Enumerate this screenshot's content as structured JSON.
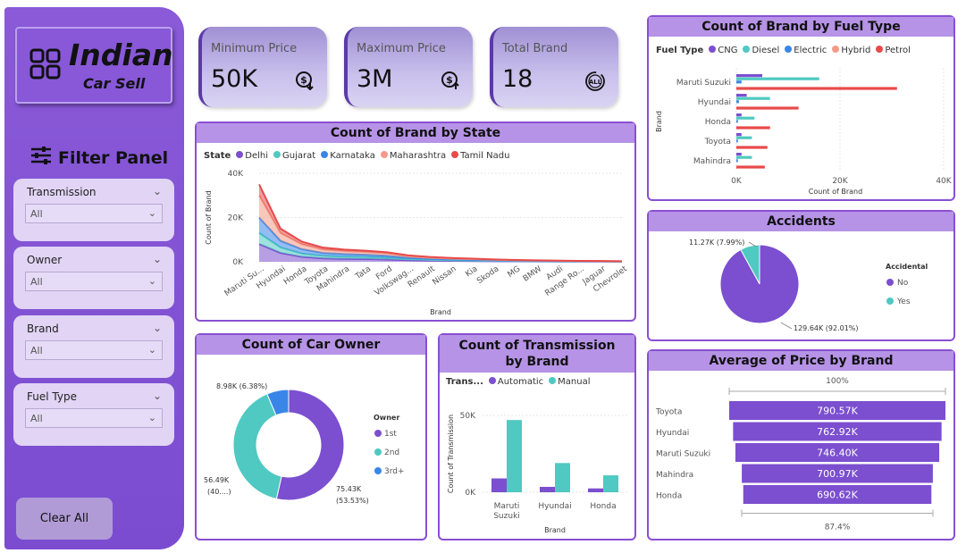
{
  "logo": {
    "title": "Indian",
    "subtitle": "Car Sell"
  },
  "filter_panel": {
    "title": "Filter Panel",
    "slicers": [
      {
        "label": "Transmission",
        "value": "All"
      },
      {
        "label": "Owner",
        "value": "All"
      },
      {
        "label": "Brand",
        "value": "All"
      },
      {
        "label": "Fuel Type",
        "value": "All"
      }
    ],
    "clear_label": "Clear All"
  },
  "kpis": [
    {
      "label": "Minimum Price",
      "value": "50K"
    },
    {
      "label": "Maximum Price",
      "value": "3M"
    },
    {
      "label": "Total Brand",
      "value": "18"
    }
  ],
  "colors": {
    "delhi": "#7b4fcf",
    "gujarat": "#4fc9c1",
    "karnataka": "#3a86e8",
    "maharashtra": "#f29a87",
    "tamilnadu": "#e84a4a"
  },
  "chart_data": [
    {
      "type": "area",
      "title": "Count of Brand by State",
      "legend_title": "State",
      "xlabel": "Brand",
      "ylabel": "Count of Brand",
      "ylim": [
        0,
        40000
      ],
      "y_ticks": [
        "40K",
        "20K",
        "0K"
      ],
      "categories": [
        "Maruti Su...",
        "Hyundai",
        "Honda",
        "Toyota",
        "Mahindra",
        "Tata",
        "Ford",
        "Volkswag...",
        "Renault",
        "Nissan",
        "Kia",
        "Skoda",
        "MG",
        "BMW",
        "Audi",
        "Range Ro...",
        "Jaguar",
        "Chevrolet"
      ],
      "series": [
        {
          "name": "Delhi",
          "values": [
            8000,
            4000,
            2200,
            1500,
            1300,
            1200,
            1000,
            700,
            500,
            400,
            300,
            250,
            200,
            150,
            120,
            100,
            80,
            60
          ]
        },
        {
          "name": "Gujarat",
          "values": [
            5000,
            2500,
            1500,
            1200,
            1000,
            900,
            800,
            500,
            400,
            300,
            250,
            200,
            150,
            120,
            100,
            80,
            60,
            50
          ]
        },
        {
          "name": "Karnataka",
          "values": [
            7000,
            3000,
            2000,
            1300,
            1200,
            1100,
            900,
            600,
            450,
            350,
            300,
            200,
            150,
            120,
            100,
            80,
            60,
            50
          ]
        },
        {
          "name": "Maharashtra",
          "values": [
            10000,
            3500,
            2200,
            1500,
            1300,
            1200,
            1100,
            700,
            500,
            400,
            350,
            250,
            200,
            150,
            120,
            100,
            80,
            60
          ]
        },
        {
          "name": "Tamil Nadu",
          "values": [
            5000,
            2000,
            1200,
            900,
            700,
            600,
            500,
            400,
            300,
            250,
            200,
            150,
            120,
            100,
            80,
            60,
            50,
            40
          ]
        }
      ]
    },
    {
      "type": "bar",
      "title": "Count of Brand by Fuel Type",
      "legend_title": "Fuel Type",
      "xlabel": "Count of Brand",
      "ylabel": "Brand",
      "xlim": [
        0,
        40000
      ],
      "x_ticks": [
        "0K",
        "20K",
        "40K"
      ],
      "categories": [
        "Maruti Suzuki",
        "Hyundai",
        "Honda",
        "Toyota",
        "Mahindra"
      ],
      "series": [
        {
          "name": "CNG",
          "values": [
            5000,
            2000,
            1000,
            1000,
            1000
          ]
        },
        {
          "name": "Diesel",
          "values": [
            16000,
            6500,
            3500,
            3000,
            3000
          ]
        },
        {
          "name": "Electric",
          "values": [
            1000,
            500,
            300,
            300,
            300
          ]
        },
        {
          "name": "Hybrid",
          "values": [
            0,
            0,
            0,
            0,
            0
          ]
        },
        {
          "name": "Petrol",
          "values": [
            31000,
            12000,
            6500,
            6000,
            5500
          ]
        }
      ]
    },
    {
      "type": "pie",
      "title": "Accidents",
      "legend_title": "Accidental",
      "slices": [
        {
          "name": "No",
          "value": 129640,
          "label": "129.64K (92.01%)"
        },
        {
          "name": "Yes",
          "value": 11270,
          "label": "11.27K (7.99%)"
        }
      ]
    },
    {
      "type": "pie",
      "title": "Count of Car Owner",
      "legend_title": "Owner",
      "slices": [
        {
          "name": "1st",
          "value": 75430,
          "label": "75.43K",
          "label2": "(53.53%)"
        },
        {
          "name": "2nd",
          "value": 56490,
          "label": "56.49K",
          "label2": "(40....)"
        },
        {
          "name": "3rd+",
          "value": 8980,
          "label": "8.98K (6.38%)"
        }
      ]
    },
    {
      "type": "bar",
      "title": "Count of Transmission by Brand",
      "legend_title": "Trans...",
      "xlabel": "Brand",
      "ylabel": "Count of Transmission",
      "ylim": [
        0,
        50000
      ],
      "y_ticks": [
        "50K",
        "0K"
      ],
      "categories": [
        "Maruti Suzuki",
        "Hyundai",
        "Honda"
      ],
      "series": [
        {
          "name": "Automatic",
          "values": [
            9000,
            3500,
            2500
          ]
        },
        {
          "name": "Manual",
          "values": [
            47000,
            19000,
            11000
          ]
        }
      ]
    },
    {
      "type": "bar",
      "title": "Average of Price by Brand",
      "top_label": "100%",
      "bottom_label": "87.4%",
      "categories": [
        "Toyota",
        "Hyundai",
        "Maruti Suzuki",
        "Mahindra",
        "Honda"
      ],
      "values": [
        790570,
        762920,
        746400,
        700970,
        690620
      ],
      "labels": [
        "790.57K",
        "762.92K",
        "746.40K",
        "700.97K",
        "690.62K"
      ]
    }
  ]
}
